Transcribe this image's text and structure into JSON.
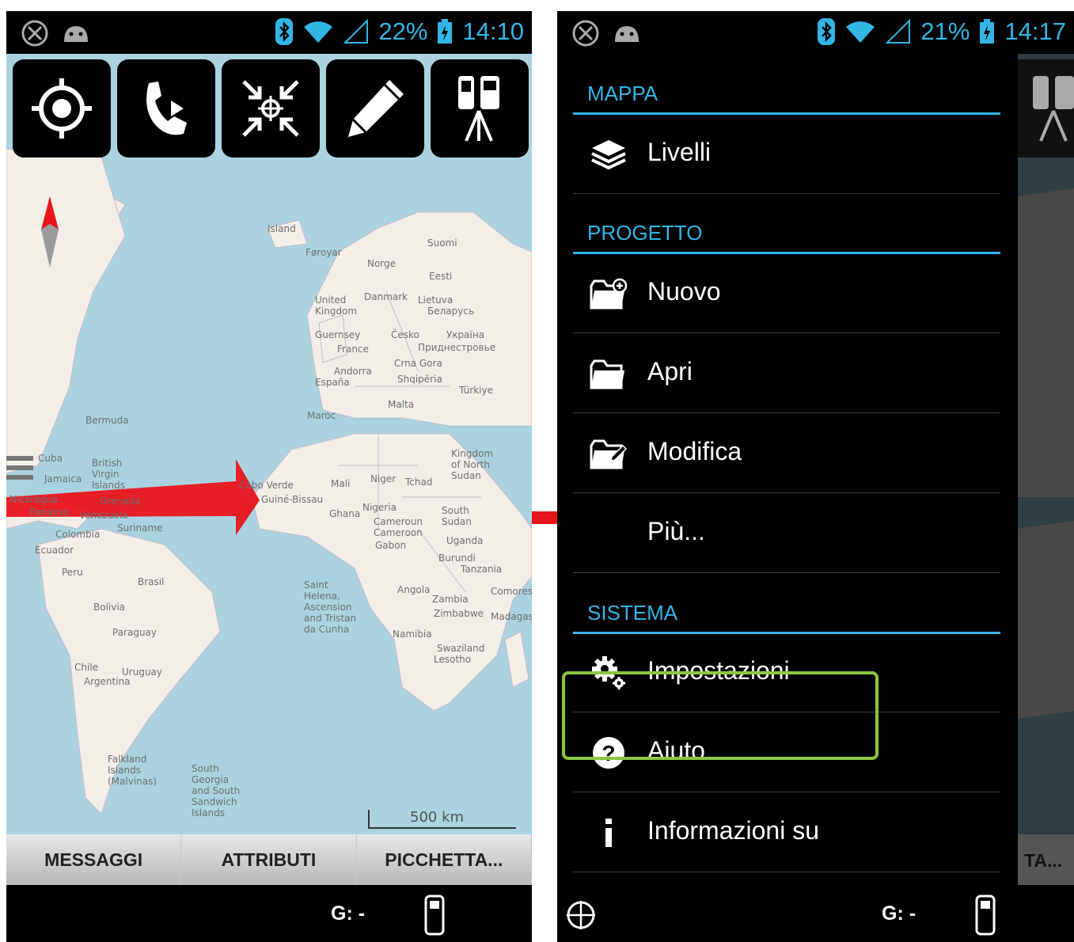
{
  "left_phone": {
    "status": {
      "battery": "22%",
      "time": "14:10"
    },
    "map_labels": [
      {
        "text": "Island"
      },
      {
        "text": "Føroyar"
      },
      {
        "text": "Norge"
      },
      {
        "text": "Suomi"
      },
      {
        "text": "Eesti"
      },
      {
        "text": "United Kingdom"
      },
      {
        "text": "Danmark"
      },
      {
        "text": "Lietuva"
      },
      {
        "text": "Беларусь"
      },
      {
        "text": "Guernsey"
      },
      {
        "text": "Česko"
      },
      {
        "text": "Україна"
      },
      {
        "text": "France"
      },
      {
        "text": "Приднестровье"
      },
      {
        "text": "Andorra"
      },
      {
        "text": "Crna Gora"
      },
      {
        "text": "España"
      },
      {
        "text": "Shqipëria"
      },
      {
        "text": "Türkiye"
      },
      {
        "text": "Malta"
      },
      {
        "text": "Maroc"
      },
      {
        "text": "Bermuda"
      },
      {
        "text": "Cuba"
      },
      {
        "text": "Jamaica"
      },
      {
        "text": "British Virgin Islands"
      },
      {
        "text": "Nicaragua"
      },
      {
        "text": "Grenada"
      },
      {
        "text": "Panama"
      },
      {
        "text": "Venezuela"
      },
      {
        "text": "Suriname"
      },
      {
        "text": "Colombia"
      },
      {
        "text": "Ecuador"
      },
      {
        "text": "Peru"
      },
      {
        "text": "Brasil"
      },
      {
        "text": "Bolivia"
      },
      {
        "text": "Paraguay"
      },
      {
        "text": "Chile"
      },
      {
        "text": "Uruguay"
      },
      {
        "text": "Argentina"
      },
      {
        "text": "Falkland Islands (Malvinas)"
      },
      {
        "text": "South Georgia and South Sandwich Islands"
      },
      {
        "text": "Cabo Verde"
      },
      {
        "text": "Guiné-Bissau"
      },
      {
        "text": "Mali"
      },
      {
        "text": "Niger"
      },
      {
        "text": "Tchad"
      },
      {
        "text": "Ghana"
      },
      {
        "text": "Nigeria"
      },
      {
        "text": "Cameroun Cameroon"
      },
      {
        "text": "Gabon"
      },
      {
        "text": "Kingdom of North Sudan"
      },
      {
        "text": "South Sudan"
      },
      {
        "text": "Uganda"
      },
      {
        "text": "Burundi"
      },
      {
        "text": "Tanzania"
      },
      {
        "text": "Angola"
      },
      {
        "text": "Zambia"
      },
      {
        "text": "Zimbabwe"
      },
      {
        "text": "Namibia"
      },
      {
        "text": "Swaziland"
      },
      {
        "text": "Lesotho"
      },
      {
        "text": "Comores"
      },
      {
        "text": "Madagas"
      },
      {
        "text": "Saint Helena, Ascension and Tristan da Cunha"
      }
    ],
    "scale": "500 km",
    "tabs": [
      "MESSAGGI",
      "ATTRIBUTI",
      "PICCHETTA..."
    ],
    "gps": "G: -"
  },
  "right_phone": {
    "status": {
      "battery": "21%",
      "time": "14:17"
    },
    "sections": [
      {
        "header": "MAPPA",
        "items": [
          {
            "label": "Livelli",
            "icon": "layers-icon"
          }
        ]
      },
      {
        "header": "PROGETTO",
        "items": [
          {
            "label": "Nuovo",
            "icon": "folder-new-icon"
          },
          {
            "label": "Apri",
            "icon": "folder-open-icon"
          },
          {
            "label": "Modifica",
            "icon": "folder-edit-icon"
          },
          {
            "label": "Più...",
            "icon": ""
          }
        ]
      },
      {
        "header": "SISTEMA",
        "items": [
          {
            "label": "Impostazioni",
            "icon": "settings-gears-icon"
          },
          {
            "label": "Aiuto",
            "icon": "help-icon"
          },
          {
            "label": "Informazioni su",
            "icon": "info-icon"
          }
        ]
      }
    ],
    "tab_partial": "TA...",
    "gps": "G: -"
  },
  "colors": {
    "accent": "#33b5e5",
    "highlight": "#8cc63f",
    "arrow": "#e8141c",
    "sea": "#aad3df",
    "land": "#f2efe9"
  }
}
